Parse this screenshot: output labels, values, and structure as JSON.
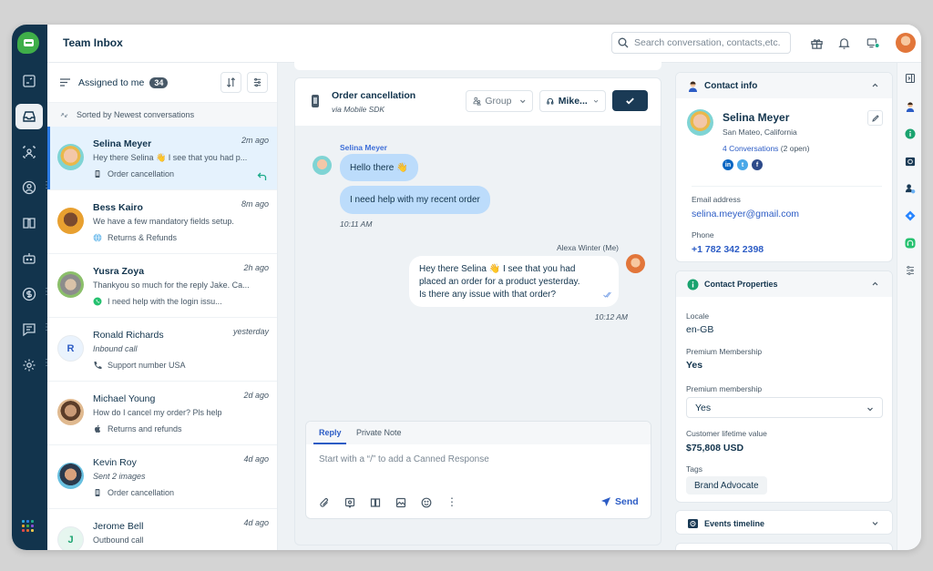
{
  "app": {
    "title": "Team Inbox",
    "search_placeholder": "Search conversation, contacts,etc."
  },
  "nav": {
    "items": [
      {
        "id": "dashboard",
        "icon": "dashboard-icon"
      },
      {
        "id": "inbox",
        "icon": "inbox-icon",
        "active": true
      },
      {
        "id": "contacts",
        "icon": "contacts-icon"
      },
      {
        "id": "profile",
        "icon": "user-circle-icon"
      },
      {
        "id": "knowledge",
        "icon": "book-icon"
      },
      {
        "id": "bot",
        "icon": "bot-icon"
      },
      {
        "id": "billing",
        "icon": "dollar-icon"
      },
      {
        "id": "messages",
        "icon": "message-icon"
      },
      {
        "id": "settings",
        "icon": "gear-icon"
      }
    ],
    "apps_colors": [
      "#2aa7df",
      "#2c7be5",
      "#1dab8a",
      "#e5a22c",
      "#3fae49",
      "#8a4fd8",
      "#e5484d",
      "#e56a2c",
      "#f2c94c"
    ]
  },
  "list": {
    "filter_label": "Assigned to me",
    "count": "34",
    "sort_text": "Sorted by Newest conversations",
    "conversations": [
      {
        "name": "Selina Meyer",
        "time": "2m ago",
        "preview": "Hey there Selina 👋 I see that you had p...",
        "channel": "mobile",
        "meta": "Order cancellation",
        "bold": true,
        "active": true,
        "replied": true
      },
      {
        "name": "Bess Kairo",
        "time": "8m ago",
        "preview": "We have a few mandatory fields setup.",
        "channel": "web",
        "meta": "Returns & Refunds",
        "bold": true
      },
      {
        "name": "Yusra Zoya",
        "time": "2h ago",
        "preview": "Thankyou so much for the reply Jake. Ca...",
        "channel": "whatsapp",
        "meta": "I need help with the login issu...",
        "bold": true
      },
      {
        "name": "Ronald Richards",
        "time": "yesterday",
        "preview": "Inbound call",
        "preview_italic": true,
        "channel": "phone",
        "meta": "Support number USA",
        "initial": "R"
      },
      {
        "name": "Michael Young",
        "time": "2d ago",
        "preview": "How do I cancel my order? Pls help",
        "channel": "apple",
        "meta": "Returns and refunds"
      },
      {
        "name": "Kevin Roy",
        "time": "4d ago",
        "preview": "Sent 2 images",
        "preview_italic": true,
        "channel": "mobile",
        "meta": "Order cancellation"
      },
      {
        "name": "Jerome Bell",
        "time": "4d ago",
        "preview": "Outbound call",
        "initial": "J"
      }
    ]
  },
  "chat": {
    "subject": "Order cancellation",
    "via": "via Mobile SDK",
    "group_label": "Group",
    "agent_label": "Mike...",
    "messages": [
      {
        "sender": "Selina Meyer",
        "texts": [
          "Hello there 👋",
          "I need help with my recent order"
        ],
        "time": "10:11 AM"
      },
      {
        "sender": "Alexa Winter (Me)",
        "text_lines": [
          "Hey there Selina 👋 I see that you had",
          "placed an order for a product yesterday.",
          "Is there any issue with that order?"
        ],
        "time": "10:12 AM"
      }
    ],
    "reply": {
      "tabs": [
        "Reply",
        "Private Note"
      ],
      "active_tab": "Reply",
      "placeholder": "Start with a “/” to add a Canned Response",
      "send_label": "Send"
    }
  },
  "contact": {
    "section_title": "Contact info",
    "name": "Selina Meyer",
    "location": "San Mateo, California",
    "conversations_link": "4 Conversations",
    "conversations_open": "(2 open)",
    "email_label": "Email address",
    "email": "selina.meyer@gmail.com",
    "phone_label": "Phone",
    "phone": "+1 782 342 2398",
    "social": [
      "in",
      "t",
      "f"
    ]
  },
  "properties": {
    "section_title": "Contact Properties",
    "locale_label": "Locale",
    "locale": "en-GB",
    "premium_label": "Premium Membership",
    "premium": "Yes",
    "premium_select_label": "Premium membership",
    "premium_select_value": "Yes",
    "ltv_label": "Customer lifetime value",
    "ltv": "$75,808 USD",
    "tags_label": "Tags",
    "tags": [
      "Brand Advocate"
    ]
  },
  "events": {
    "section_title": "Events timeline"
  }
}
